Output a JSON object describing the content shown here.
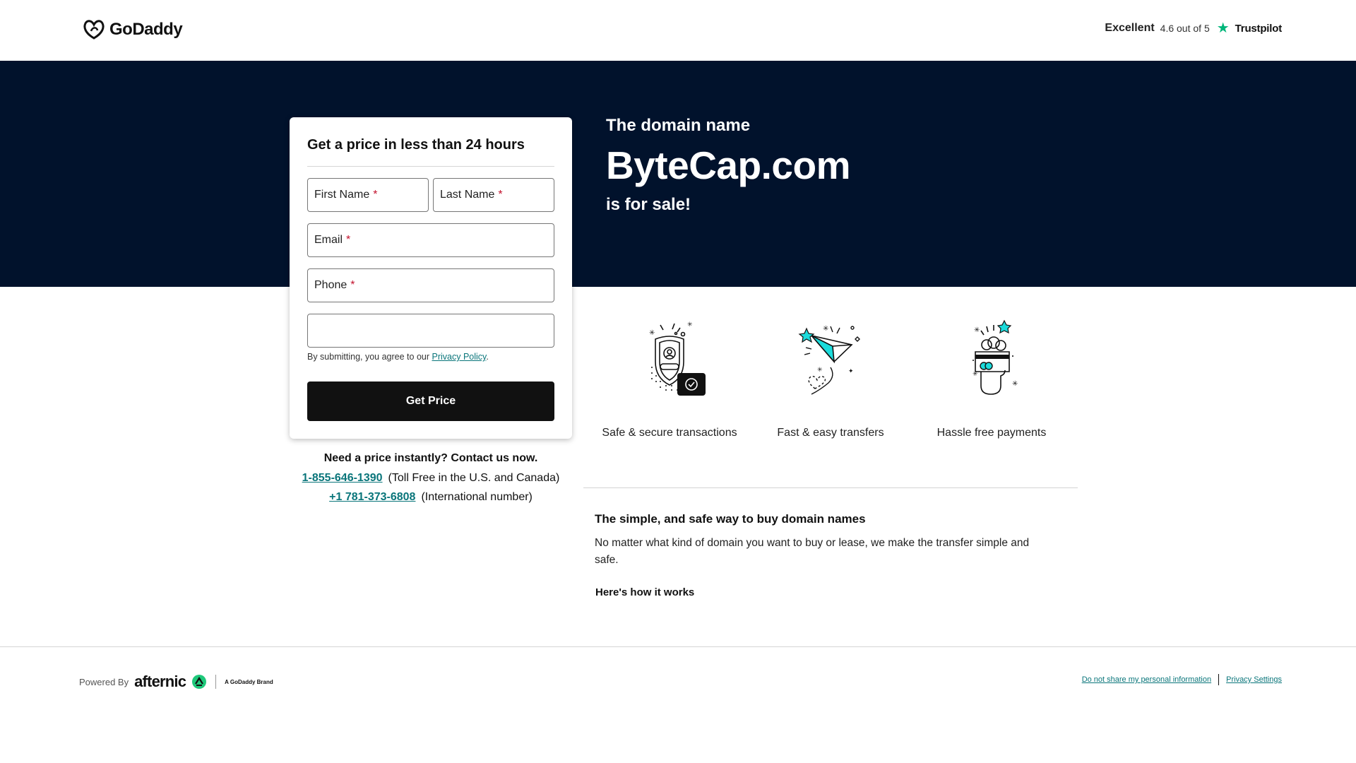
{
  "header": {
    "logo_text": "GoDaddy",
    "trustpilot": {
      "rating_word": "Excellent",
      "score_text": "4.6 out of 5",
      "brand": "Trustpilot"
    }
  },
  "hero": {
    "pre_text": "The domain name",
    "domain": "ByteCap.com",
    "post_text": "is for sale!"
  },
  "form": {
    "title": "Get a price in less than 24 hours",
    "fields": {
      "first_name": "First Name",
      "last_name": "Last Name",
      "email": "Email",
      "phone": "Phone",
      "required_mark": "*"
    },
    "consent_text": "By submitting, you agree to our",
    "privacy_link": "Privacy Policy",
    "consent_end": ".",
    "submit_label": "Get Price"
  },
  "contact": {
    "heading": "Need a price instantly? Contact us now.",
    "toll_free_number": "1-855-646-1390",
    "toll_free_note": "(Toll Free in the U.S. and Canada)",
    "intl_number": "+1 781-373-6808",
    "intl_note": "(International number)"
  },
  "features": [
    {
      "label": "Safe & secure transactions",
      "icon": "shield-icon"
    },
    {
      "label": "Fast & easy transfers",
      "icon": "paper-plane-icon"
    },
    {
      "label": "Hassle free payments",
      "icon": "credit-card-hand-icon"
    }
  ],
  "info": {
    "title": "The simple, and safe way to buy domain names",
    "text": "No matter what kind of domain you want to buy or lease, we make the transfer simple and safe.",
    "how_it_works": "Here's how it works"
  },
  "footer": {
    "powered_by": "Powered By",
    "afternic": "afternic",
    "brand_tag": "A GoDaddy Brand",
    "do_not_share": "Do not share my personal information",
    "privacy_settings": "Privacy Settings"
  },
  "colors": {
    "hero_bg": "#01122c",
    "link": "#09757a",
    "button_bg": "#111111",
    "required": "#c3122d",
    "trustpilot_star": "#00b67a",
    "accent_teal": "#1bdbdb"
  }
}
